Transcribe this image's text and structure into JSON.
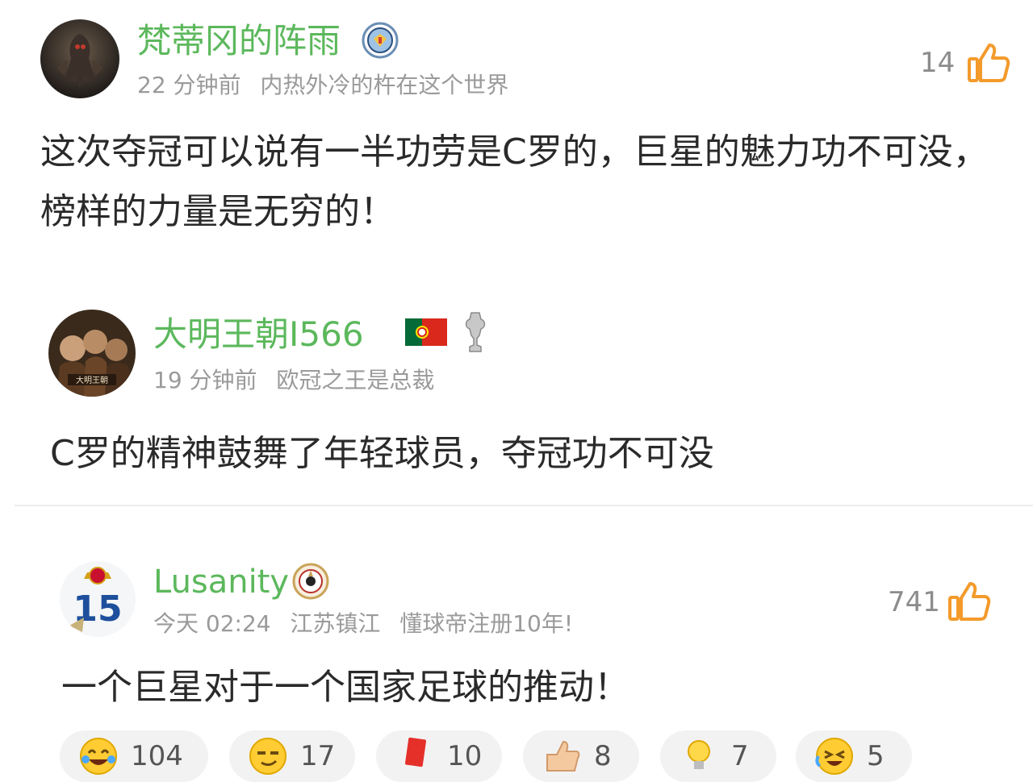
{
  "comments": [
    {
      "username": "梵蒂冈的阵雨",
      "time": "22 分钟前",
      "signature": "内热外冷的杵在这个世界",
      "text": "这次夺冠可以说有一半功劳是C罗的，巨星的魅力功不可没，榜样的力量是无穷的！",
      "likes": "14"
    },
    {
      "username": "大明王朝I566",
      "time": "19 分钟前",
      "signature": "欧冠之王是总裁",
      "text": "C罗的精神鼓舞了年轻球员，夺冠功不可没"
    },
    {
      "username": "Lusanity",
      "time": "今天 02:24",
      "location": "江苏镇江",
      "signature": "懂球帝注册10年!",
      "text": "一个巨星对于一个国家足球的推动！",
      "likes": "741",
      "avatar_text": "15"
    }
  ],
  "reactions": [
    {
      "icon": "crying-laugh-emoji-icon",
      "count": "104"
    },
    {
      "icon": "smirk-emoji-icon",
      "count": "17"
    },
    {
      "icon": "red-card-icon",
      "count": "10"
    },
    {
      "icon": "thumbs-up-hand-icon",
      "count": "8"
    },
    {
      "icon": "lightbulb-icon",
      "count": "7"
    },
    {
      "icon": "laughing-tears-emoji-icon",
      "count": "5"
    }
  ],
  "colors": {
    "username": "#5cb85c",
    "like_icon": "#f39a2b",
    "meta": "#9a9a9a"
  }
}
